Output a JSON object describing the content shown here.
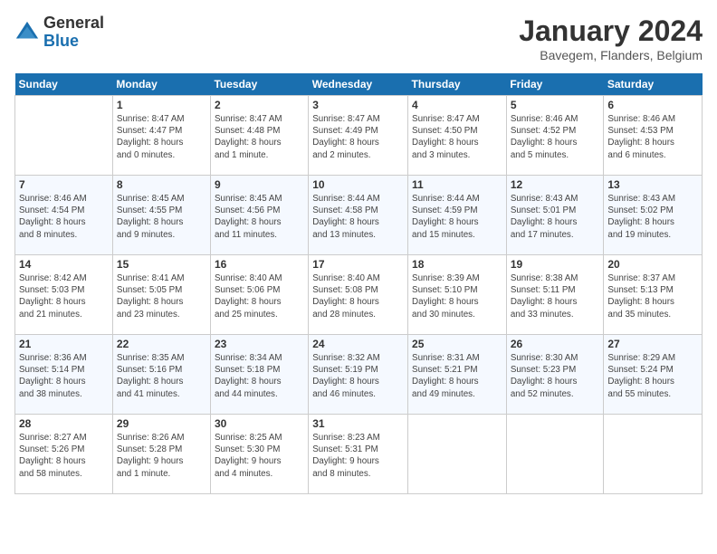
{
  "header": {
    "logo": {
      "general": "General",
      "blue": "Blue"
    },
    "title": "January 2024",
    "location": "Bavegem, Flanders, Belgium"
  },
  "days_of_week": [
    "Sunday",
    "Monday",
    "Tuesday",
    "Wednesday",
    "Thursday",
    "Friday",
    "Saturday"
  ],
  "weeks": [
    [
      {
        "day": "",
        "info": ""
      },
      {
        "day": "1",
        "info": "Sunrise: 8:47 AM\nSunset: 4:47 PM\nDaylight: 8 hours\nand 0 minutes."
      },
      {
        "day": "2",
        "info": "Sunrise: 8:47 AM\nSunset: 4:48 PM\nDaylight: 8 hours\nand 1 minute."
      },
      {
        "day": "3",
        "info": "Sunrise: 8:47 AM\nSunset: 4:49 PM\nDaylight: 8 hours\nand 2 minutes."
      },
      {
        "day": "4",
        "info": "Sunrise: 8:47 AM\nSunset: 4:50 PM\nDaylight: 8 hours\nand 3 minutes."
      },
      {
        "day": "5",
        "info": "Sunrise: 8:46 AM\nSunset: 4:52 PM\nDaylight: 8 hours\nand 5 minutes."
      },
      {
        "day": "6",
        "info": "Sunrise: 8:46 AM\nSunset: 4:53 PM\nDaylight: 8 hours\nand 6 minutes."
      }
    ],
    [
      {
        "day": "7",
        "info": "Sunrise: 8:46 AM\nSunset: 4:54 PM\nDaylight: 8 hours\nand 8 minutes."
      },
      {
        "day": "8",
        "info": "Sunrise: 8:45 AM\nSunset: 4:55 PM\nDaylight: 8 hours\nand 9 minutes."
      },
      {
        "day": "9",
        "info": "Sunrise: 8:45 AM\nSunset: 4:56 PM\nDaylight: 8 hours\nand 11 minutes."
      },
      {
        "day": "10",
        "info": "Sunrise: 8:44 AM\nSunset: 4:58 PM\nDaylight: 8 hours\nand 13 minutes."
      },
      {
        "day": "11",
        "info": "Sunrise: 8:44 AM\nSunset: 4:59 PM\nDaylight: 8 hours\nand 15 minutes."
      },
      {
        "day": "12",
        "info": "Sunrise: 8:43 AM\nSunset: 5:01 PM\nDaylight: 8 hours\nand 17 minutes."
      },
      {
        "day": "13",
        "info": "Sunrise: 8:43 AM\nSunset: 5:02 PM\nDaylight: 8 hours\nand 19 minutes."
      }
    ],
    [
      {
        "day": "14",
        "info": "Sunrise: 8:42 AM\nSunset: 5:03 PM\nDaylight: 8 hours\nand 21 minutes."
      },
      {
        "day": "15",
        "info": "Sunrise: 8:41 AM\nSunset: 5:05 PM\nDaylight: 8 hours\nand 23 minutes."
      },
      {
        "day": "16",
        "info": "Sunrise: 8:40 AM\nSunset: 5:06 PM\nDaylight: 8 hours\nand 25 minutes."
      },
      {
        "day": "17",
        "info": "Sunrise: 8:40 AM\nSunset: 5:08 PM\nDaylight: 8 hours\nand 28 minutes."
      },
      {
        "day": "18",
        "info": "Sunrise: 8:39 AM\nSunset: 5:10 PM\nDaylight: 8 hours\nand 30 minutes."
      },
      {
        "day": "19",
        "info": "Sunrise: 8:38 AM\nSunset: 5:11 PM\nDaylight: 8 hours\nand 33 minutes."
      },
      {
        "day": "20",
        "info": "Sunrise: 8:37 AM\nSunset: 5:13 PM\nDaylight: 8 hours\nand 35 minutes."
      }
    ],
    [
      {
        "day": "21",
        "info": "Sunrise: 8:36 AM\nSunset: 5:14 PM\nDaylight: 8 hours\nand 38 minutes."
      },
      {
        "day": "22",
        "info": "Sunrise: 8:35 AM\nSunset: 5:16 PM\nDaylight: 8 hours\nand 41 minutes."
      },
      {
        "day": "23",
        "info": "Sunrise: 8:34 AM\nSunset: 5:18 PM\nDaylight: 8 hours\nand 44 minutes."
      },
      {
        "day": "24",
        "info": "Sunrise: 8:32 AM\nSunset: 5:19 PM\nDaylight: 8 hours\nand 46 minutes."
      },
      {
        "day": "25",
        "info": "Sunrise: 8:31 AM\nSunset: 5:21 PM\nDaylight: 8 hours\nand 49 minutes."
      },
      {
        "day": "26",
        "info": "Sunrise: 8:30 AM\nSunset: 5:23 PM\nDaylight: 8 hours\nand 52 minutes."
      },
      {
        "day": "27",
        "info": "Sunrise: 8:29 AM\nSunset: 5:24 PM\nDaylight: 8 hours\nand 55 minutes."
      }
    ],
    [
      {
        "day": "28",
        "info": "Sunrise: 8:27 AM\nSunset: 5:26 PM\nDaylight: 8 hours\nand 58 minutes."
      },
      {
        "day": "29",
        "info": "Sunrise: 8:26 AM\nSunset: 5:28 PM\nDaylight: 9 hours\nand 1 minute."
      },
      {
        "day": "30",
        "info": "Sunrise: 8:25 AM\nSunset: 5:30 PM\nDaylight: 9 hours\nand 4 minutes."
      },
      {
        "day": "31",
        "info": "Sunrise: 8:23 AM\nSunset: 5:31 PM\nDaylight: 9 hours\nand 8 minutes."
      },
      {
        "day": "",
        "info": ""
      },
      {
        "day": "",
        "info": ""
      },
      {
        "day": "",
        "info": ""
      }
    ]
  ]
}
